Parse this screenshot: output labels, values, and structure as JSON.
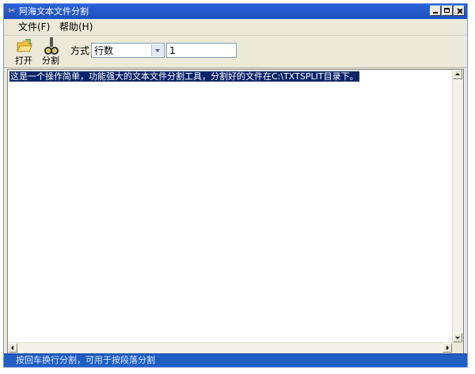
{
  "window": {
    "title": "阿海文本文件分割"
  },
  "menu": {
    "file": "文件(F)",
    "help": "帮助(H)"
  },
  "toolbar": {
    "open_label": "打开",
    "split_label": "分割",
    "mode_label": "方式",
    "mode_value": "行数",
    "count_value": "1"
  },
  "editor": {
    "text": "这是一个操作简单，功能强大的文本文件分割工具，分割好的文件在C:\\TXTSPLIT目录下。"
  },
  "status": {
    "text": "按回车换行分割，可用于按段落分割"
  },
  "colors": {
    "titlebar": "#1e4fbf",
    "selection": "#0a246a",
    "statusbar": "#1f5fc4"
  }
}
